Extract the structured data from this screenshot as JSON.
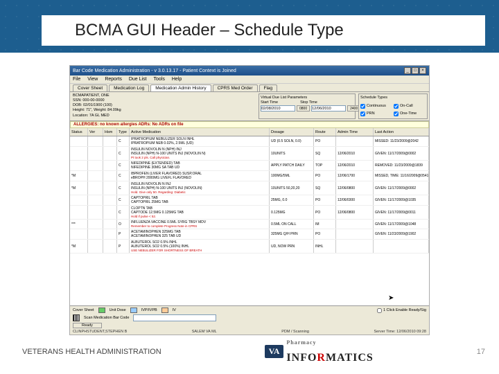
{
  "slide": {
    "title": "BCMA GUI Header – Schedule Type",
    "page_number": "17"
  },
  "window_title": "Bar Code Medication Administration - v 3.0.13.17 - Patient Context is Joined",
  "menus": [
    "File",
    "View",
    "Reports",
    "Due List",
    "Tools",
    "Help"
  ],
  "tabs": {
    "t1": "Cover Sheet",
    "t2": "Medication Log",
    "t3": "Medication Admin History",
    "t4": "CPRS Med Order",
    "t5": "Flag"
  },
  "patient": {
    "name": "BCMAPATIENT, ONE",
    "ssn": "SSN: 000-00-0000",
    "dob": "DOB: 02/01/1900 (100)",
    "hw": "Height: 71\", Weight: 84.09kg",
    "loc": "Location: 7A GL MED"
  },
  "vdl": {
    "title": "Virtual Due List Parameters",
    "start_label": "Start Time",
    "stop_label": "Stop Time",
    "start": "02/08/2010",
    "start_hr": "0800",
    "stop": "12/06/2010",
    "stop_hr": "2400"
  },
  "schedule": {
    "title": "Schedule Types",
    "s1": "Continuous",
    "s2": "On-Call",
    "s3": "PRN",
    "s4": "One-Time",
    "chk1": true,
    "chk2": true,
    "chk3": true,
    "chk4": true
  },
  "allergy_bar": "ALLERGIES: no known allergies    ADRs: No ADRs on file",
  "cols": {
    "status": "Status",
    "ver": "Ver",
    "hsm": "Hsm",
    "type": "Type",
    "med": "Active Medication",
    "dosage": "Dosage",
    "route": "Route",
    "admin": "Admin Time",
    "last": "Last Action"
  },
  "rows": [
    {
      "status": "",
      "type": "C",
      "med1": "IPRATROPIUM NEBULIZER SOLN INHL",
      "med2": "IPRATROPIUM NEB 0.02%, 2.5ML (UD)",
      "dosage": "UD (0.5 SOLN, 0.0)",
      "route": "PO",
      "admin": "",
      "last": "MISSED: 11/23/2009@2042"
    },
    {
      "status": "",
      "type": "C",
      "med1": "INSULIN NOVOLIN N (NPH) INJ",
      "med2": "INSULIN (NPH) N-100 UNITS INJ (NOVOLIN N)",
      "warn": "Pt took 2 pls. Call physician.",
      "dosage": "10UNITS",
      "route": "SQ",
      "admin": "12/06/2010",
      "last": "GIVEN: 11/17/2009@0002"
    },
    {
      "status": "",
      "type": "C",
      "med1": "NIFEDIPINE (EXTENDED) TAB",
      "med2": "NIFEDIPINE 30MG SA TAB UD",
      "dosage": "APPLY PATCH DAILY",
      "route": "TOP",
      "admin": "12/06/2010",
      "last": "REMOVED: 11/23/2009@1839"
    },
    {
      "status": "*M",
      "type": "C",
      "med1": "IBPROFEN (LIVER FLAVORED) SUSP,ORAL",
      "med2": "eBROPH 2000MG LIVEFL FLAVORED",
      "warn": "",
      "dosage": "100MG/5ML",
      "route": "PO",
      "admin": "12/06/1700",
      "last": "MISSED, TIME: 11/16/2009@0541"
    },
    {
      "status": "*M",
      "type": "C",
      "med1": "INSULIN NOVOLIN N INJ",
      "med2": "INSULIN (NPH) N-100 UNITS INJ (NOVOLIN)",
      "warn": "Hold. Give only 50. Regarding: Diabetic",
      "dosage": "10UNITS 50,20,20",
      "route": "SQ",
      "admin": "12/06/0800",
      "last": "GIVEN: 11/17/2009@0002"
    },
    {
      "status": "",
      "type": "C",
      "med1": "CAPTOPRIL TAB",
      "med2": "CAPTOPRIL 25MG TAB",
      "dosage": "25MG, 0.0",
      "route": "PO",
      "admin": "12/06/0300",
      "last": "GIVEN: 11/17/2009@1035"
    },
    {
      "status": "",
      "type": "C",
      "med1": "CLOPTN TAB",
      "med2": "CAPTODE 12.5MG 0.125MG TAB",
      "warn": "Hold if pulse < 52.",
      "dosage": "0.125MG",
      "route": "PO",
      "admin": "12/06/0800",
      "last": "GIVEN: 11/17/2009@0011"
    },
    {
      "status": "***",
      "type": "O",
      "med1": "INFLUENZA VACCINE 0.5ML SYRG TBSY MDV",
      "med2": "",
      "warn": "Remember to complete Progress Note in CPRS",
      "dosage": "0.5ML ON CALL",
      "route": "IM",
      "admin": "",
      "last": "GIVEN: 11/17/2009@1048"
    },
    {
      "status": "",
      "type": "P",
      "med1": "ACETAMINOPHEN 325MG TAB",
      "med2": "ACETAMINOPHEN 325 TAB UD",
      "warn": "",
      "dosage": "325MG Q/H PRN",
      "route": "PO",
      "admin": "",
      "last": "GIVEN: 11/23/2009@1902"
    },
    {
      "status": "*M",
      "type": "P",
      "med1": "ALBUTEROL SO2 0.5% INHL",
      "med2": "ALBUTEROL SO2 0.5% (100%) INHL",
      "warn": "USE NEBULIZER FOR SHORTNESS OF BREATH",
      "dosage": "UD, NOW PRN",
      "route": "INHL",
      "admin": "",
      "last": ""
    }
  ],
  "bottom": {
    "cover_label": "Cover Sheet",
    "unit_dose": "Unit Dose",
    "ivp_ivpb": "IVP/IVPB",
    "iv": "IV",
    "scan_label": "Scan Medication Bar Code",
    "ready": "Ready",
    "enable_label": "1 Click Enable Ready/Sig",
    "status_left": "CLINPHSTUDENT,STEPHEN B",
    "status_mid": "SALEM VA ML",
    "status_right1": "PDM / Scanning",
    "status_right2": "Server Time: 12/06/2010 09:28"
  },
  "footer": {
    "vha": "VETERANS HEALTH ADMINISTRATION",
    "pharmacy": "Pharmacy",
    "brand1": "INFO",
    "brand2": "R",
    "brand3": "MATICS"
  }
}
